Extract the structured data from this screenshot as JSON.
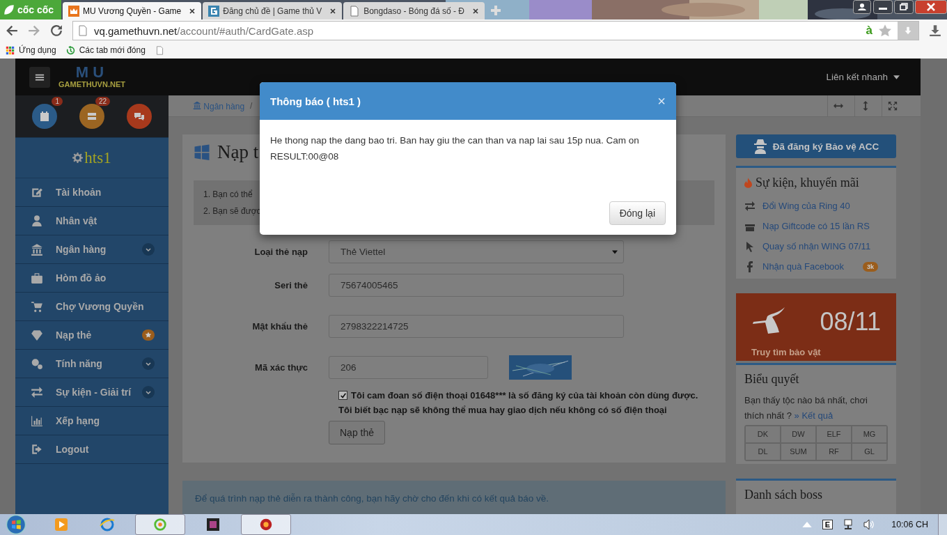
{
  "browser": {
    "brand": "cốc cốc",
    "tabs": [
      {
        "title": "MU Vương Quyền - Game",
        "selected": true
      },
      {
        "title": "Đăng chủ đề | Game thủ V",
        "selected": false
      },
      {
        "title": "Bongdaso - Bóng đá số - Đ",
        "selected": false
      }
    ],
    "url_host": "vq.gamethuvn.net",
    "url_path": "/account/#auth/CardGate.asp",
    "typing_mark": "à",
    "bookmarks": [
      {
        "label": "Ứng dụng"
      },
      {
        "label": "Các tab mới đóng"
      }
    ]
  },
  "site": {
    "logo_mark": "MU",
    "logo": "GAMETHUVN.NET",
    "quick_links": "Liên kết nhanh",
    "shortcuts": [
      {
        "badge": "1",
        "color": "#2b5b88"
      },
      {
        "badge": "22",
        "color": "#9b6522"
      },
      {
        "color": "#a7391c"
      }
    ],
    "user": "hts1",
    "menu": [
      {
        "label": "Tài khoản",
        "kind": "plain"
      },
      {
        "label": "Nhân vật",
        "kind": "plain"
      },
      {
        "label": "Ngân hàng",
        "kind": "dropdown"
      },
      {
        "label": "Hòm đồ ảo",
        "kind": "plain"
      },
      {
        "label": "Chợ Vương Quyền",
        "kind": "plain"
      },
      {
        "label": "Nạp thẻ",
        "kind": "star"
      },
      {
        "label": "Tính năng",
        "kind": "dropdown"
      },
      {
        "label": "Sự kiện - Giải trí",
        "kind": "dropdown"
      },
      {
        "label": "Xếp hạng",
        "kind": "plain"
      },
      {
        "label": "Logout",
        "kind": "plain"
      }
    ],
    "breadcrumb": {
      "label": "Ngân hàng",
      "separator": "/"
    },
    "page_title": "Nạp t",
    "notes": [
      "1. Bạn có thể",
      "2. Bạn sẽ được"
    ],
    "form": {
      "fields": [
        {
          "label": "Loại thẻ nạp",
          "value": "Thẻ Viettel",
          "kind": "select"
        },
        {
          "label": "Seri thẻ",
          "value": "75674005465",
          "kind": "text"
        },
        {
          "label": "Mật khẩu thẻ",
          "value": "2798322214725",
          "kind": "text"
        },
        {
          "label": "Mã xác thực",
          "value": "206",
          "kind": "captcha"
        }
      ],
      "agree": {
        "checked": true,
        "text": "Tôi cam đoan số điện thoại 01648*** là số đăng ký của tài khoản còn dùng được."
      },
      "warning": "Tôi biết bạc nạp sẽ không thể mua hay giao dịch nếu không có số điện thoại",
      "submit": "Nạp thẻ"
    },
    "bottom_note": "Để quá trình nạp thẻ diễn ra thành công, bạn hãy chờ cho đến khi có kết quả báo về."
  },
  "aside": {
    "protect_button": "Đã đăng ký Bảo vệ ACC",
    "events": {
      "title": "Sự kiện, khuyến mãi",
      "items": [
        {
          "label": "Đổi Wing của Ring 40"
        },
        {
          "label": "Nạp Giftcode có 15 lần RS"
        },
        {
          "label": "Quay số nhận WING 07/11"
        },
        {
          "label": "Nhận quà Facebook",
          "badge": "3k"
        }
      ]
    },
    "treasure": {
      "date": "08/11",
      "label": "Truy tìm bảo vật"
    },
    "poll": {
      "title": "Biểu quyết",
      "question": "Bạn thấy tộc nào bá nhất, chơi thích nhất ?",
      "result_link": "» Kết quả",
      "options": [
        "DK",
        "DW",
        "ELF",
        "MG",
        "DL",
        "SUM",
        "RF",
        "GL"
      ]
    },
    "boss_title": "Danh sách boss"
  },
  "modal": {
    "title": "Thông báo ( hts1 )",
    "close": "×",
    "lines": [
      "He thong nap the dang bao tri. Ban hay giu the can than va nap lai sau 15p nua. Cam on",
      "RESULT:00@08"
    ],
    "button": "Đóng lại"
  },
  "taskbar": {
    "language": "E",
    "clock": "10:06 CH"
  }
}
